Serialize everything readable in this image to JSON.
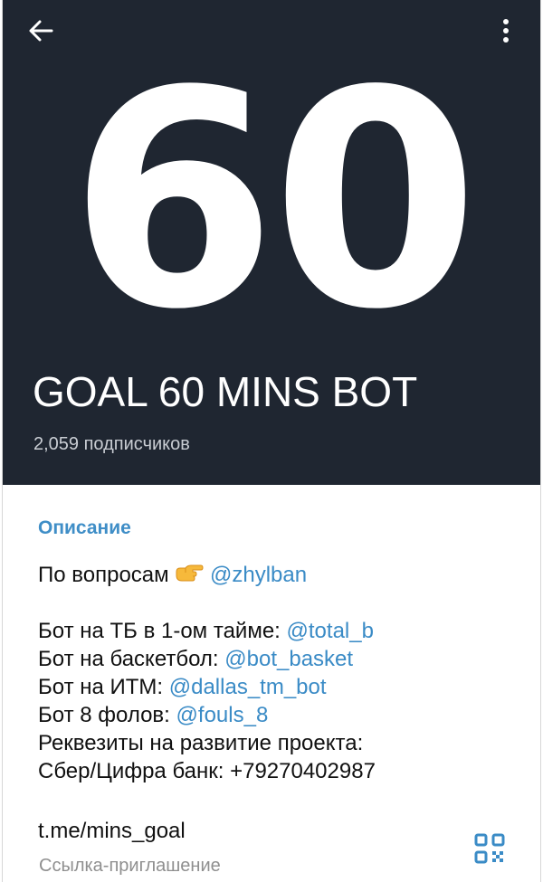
{
  "header": {
    "avatar_text": "60",
    "channel_name": "GOAL 60 MINS BOT",
    "subscribers": "2,059 подписчиков"
  },
  "icons": {
    "back": "arrow-left-icon",
    "menu": "more-vertical-icon",
    "pointing": "backhand-index-pointing-right-emoji",
    "qr": "qr-code-icon"
  },
  "description": {
    "title": "Описание",
    "line1_text": "По вопросам",
    "line1_link": "@zhylban",
    "line2_text": "Бот на ТБ в 1-ом тайме:",
    "line2_link": "@total_b",
    "line3_text": "Бот на баскетбол:",
    "line3_link": "@bot_basket",
    "line4_text": "Бот на ИТМ:",
    "line4_link": "@dallas_tm_bot",
    "line5_text": "Бот 8 фолов:",
    "line5_link": "@fouls_8",
    "line6_text": "Реквезиты на развитие проекта:",
    "line7_text": "Сбер/Цифра банк: +79270402987"
  },
  "invite": {
    "link": "t.me/mins_goal",
    "caption": "Ссылка-приглашение"
  },
  "colors": {
    "header_bg": "#1f2631",
    "accent": "#3f8ec7",
    "link": "#3a8bc6"
  }
}
